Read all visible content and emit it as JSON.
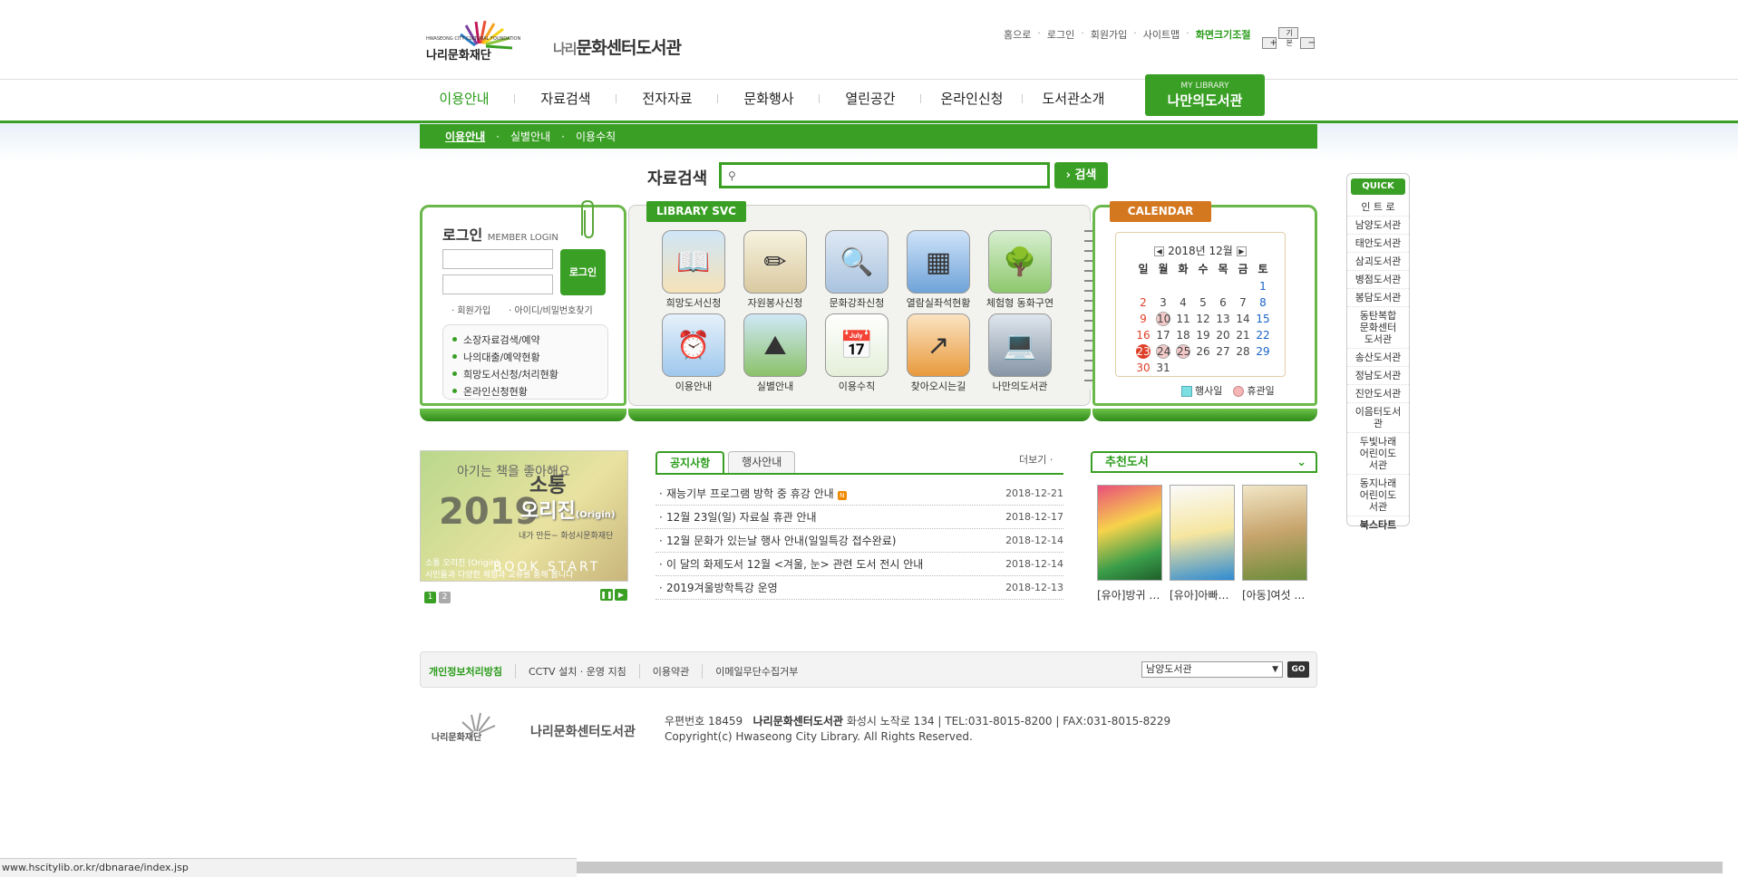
{
  "header": {
    "foundation_name": "나리문화재단",
    "foundation_sub": "HWASEONG CITY CULTURAL FOUNDATION",
    "library_name": "문화센터도서관",
    "library_prefix": "나리",
    "top_links": [
      "홈으로",
      "로그인",
      "회원가입",
      "사이트맵"
    ],
    "text_size_label": "화면크기조절",
    "text_size_buttons": [
      "+",
      "기본",
      "−"
    ]
  },
  "gnb": {
    "items": [
      "이용안내",
      "자료검색",
      "전자자료",
      "문화행사",
      "열린공간",
      "온라인신청",
      "도서관소개"
    ],
    "active": "이용안내",
    "mylib_small": "MY LIBRARY",
    "mylib_label": "나만의도서관"
  },
  "submenu": {
    "items": [
      "이용안내",
      "실별안내",
      "이용수칙"
    ],
    "active": "이용안내"
  },
  "search": {
    "label": "자료검색",
    "value": "",
    "button": "› 검색"
  },
  "login": {
    "title": "로그인",
    "title_en": "MEMBER LOGIN",
    "button": "로그인",
    "links": [
      "· 회원가입",
      "· 아이디/비밀번호찾기"
    ],
    "menu": [
      "소장자료검색/예약",
      "나의대출/예약현황",
      "희망도서신청/처리현황",
      "온라인신청현황"
    ]
  },
  "svc": {
    "tab": "LIBRARY SVC",
    "items": [
      {
        "label": "희망도서신청",
        "icon": "📖"
      },
      {
        "label": "자원봉사신청",
        "icon": "✏"
      },
      {
        "label": "문화강좌신청",
        "icon": "🔍"
      },
      {
        "label": "열람실좌석현황",
        "icon": "▦"
      },
      {
        "label": "체험형 동화구연",
        "icon": "🌳"
      },
      {
        "label": "이용안내",
        "icon": "⏰"
      },
      {
        "label": "실별안내",
        "icon": "⛰"
      },
      {
        "label": "이용수칙",
        "icon": "📅"
      },
      {
        "label": "찾아오시는길",
        "icon": "↗"
      },
      {
        "label": "나만의도서관",
        "icon": "💻"
      }
    ]
  },
  "calendar": {
    "tab": "CALENDAR",
    "title": "2018년 12월",
    "weekdays": [
      "월",
      "화",
      "수",
      "목",
      "금",
      "토"
    ],
    "weekdays_sun": "일",
    "legend_event": "행사일",
    "legend_holiday": "휴관일",
    "rows": [
      [
        "",
        "",
        "",
        "",
        "",
        "1"
      ],
      [
        "2",
        "3",
        "4",
        "5",
        "6",
        "7",
        "8"
      ],
      [
        "9",
        "10",
        "11",
        "12",
        "13",
        "14",
        "15"
      ],
      [
        "16",
        "17",
        "18",
        "19",
        "20",
        "21",
        "22"
      ],
      [
        "23",
        "24",
        "25",
        "26",
        "27",
        "28",
        "29"
      ],
      [
        "30",
        "31",
        "",
        "",
        "",
        "",
        ""
      ]
    ]
  },
  "banner": {
    "line1": "아기는 책을 좋아해요",
    "line2": "소통",
    "line3": "오리진",
    "line3_en": "(Origin)",
    "year": "2019",
    "sub": "내가 만든~ 화성시문화재단",
    "caption": "소통 오리진 (Origin)",
    "caption_sub": "시민들과 다양한 체험과 교류를 통해 봅니다",
    "bookstart": "BOOK START",
    "pages": [
      "1",
      "2"
    ]
  },
  "notice": {
    "tabs": [
      "공지사항",
      "행사안내"
    ],
    "more": "더보기 ·",
    "items": [
      {
        "title": "재능기부 프로그램 방학 중 휴강 안내",
        "date": "2018-12-21",
        "new": "N"
      },
      {
        "title": "12월 23일(일) 자료실 휴관 안내",
        "date": "2018-12-17"
      },
      {
        "title": "12월 문화가 있는날 행사 안내(일일특강 접수완료)",
        "date": "2018-12-14"
      },
      {
        "title": "이 달의 화제도서 12월 <겨울, 눈> 관련 도서 전시 안내",
        "date": "2018-12-14"
      },
      {
        "title": "2019겨울방학특강 운영",
        "date": "2018-12-13"
      }
    ]
  },
  "recommend": {
    "title": "추천도서",
    "books": [
      "[유아]방귀 …",
      "[유아]아빠…",
      "[아동]여섯 …"
    ]
  },
  "quick": {
    "title": "QUICK",
    "items": [
      "인 트 로",
      "남양도서관",
      "태안도서관",
      "삼괴도서관",
      "병점도서관",
      "봉담도서관",
      "동탄복합문화센터도서관",
      "송산도서관",
      "정남도서관",
      "진안도서관",
      "이음터도서관",
      "두빛나래어린이도서관",
      "동지나래어린이도서관",
      "북스타트"
    ]
  },
  "footer": {
    "links": [
      "개인정보처리방침",
      "CCTV 설치 · 운영 지침",
      "이용약관",
      "이메일무단수집거부"
    ],
    "select": "남양도서관",
    "go": "GO",
    "addr_line1_pre": "우편번호 18459",
    "addr_name": "나리문화센터도서관",
    "addr_line1_post": "화성시 노작로 134 | TEL:031-8015-8200 | FAX:031-8015-8229",
    "addr_line2": "Copyright(c) Hwaseong City Library. All Rights Reserved.",
    "logo1": "나리문화재단",
    "logo2": "나리문화센터도서관"
  },
  "status": {
    "url": "www.hscitylib.or.kr/dbnarae/index.jsp"
  }
}
